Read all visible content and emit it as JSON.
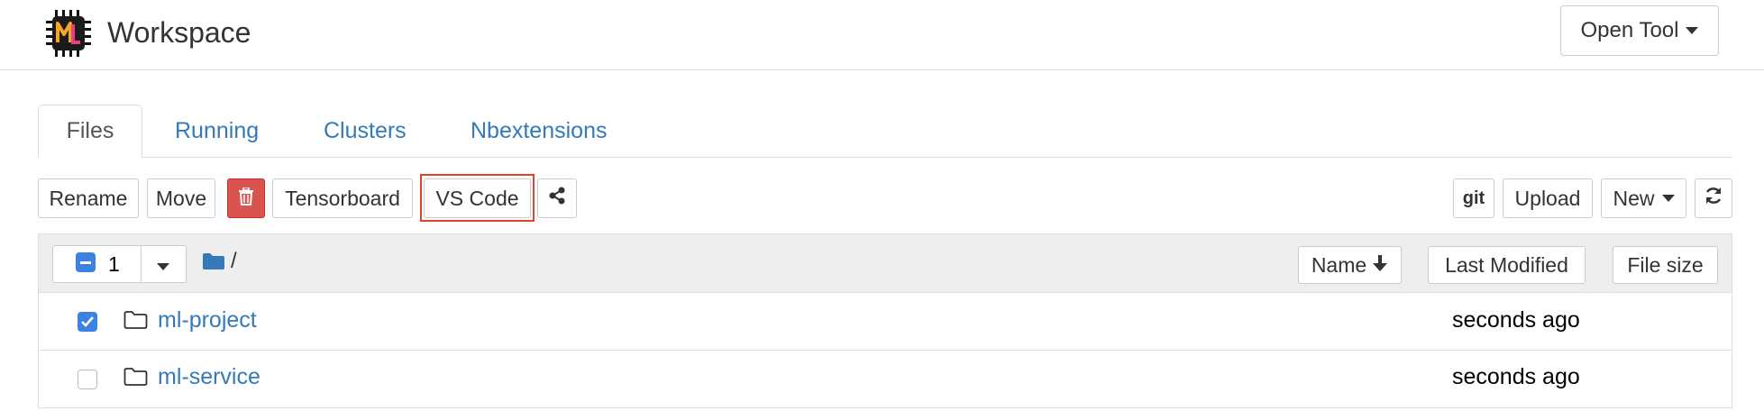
{
  "header": {
    "title": "Workspace",
    "logo_text": "ML",
    "open_tool_label": "Open Tool"
  },
  "tabs": [
    {
      "label": "Files",
      "active": true
    },
    {
      "label": "Running",
      "active": false
    },
    {
      "label": "Clusters",
      "active": false
    },
    {
      "label": "Nbextensions",
      "active": false
    }
  ],
  "toolbar": {
    "rename": "Rename",
    "move": "Move",
    "delete_icon": "trash-icon",
    "tensorboard": "Tensorboard",
    "vscode": "VS Code",
    "share_icon": "share-icon",
    "git": "git",
    "upload": "Upload",
    "new": "New",
    "refresh_icon": "refresh-icon"
  },
  "list": {
    "selected_count": "1",
    "path": "/",
    "columns": {
      "name": "Name",
      "last_modified": "Last Modified",
      "file_size": "File size"
    },
    "items": [
      {
        "name": "ml-project",
        "modified": "seconds ago",
        "checked": true
      },
      {
        "name": "ml-service",
        "modified": "seconds ago",
        "checked": false
      }
    ]
  },
  "colors": {
    "link": "#337ab7",
    "danger": "#d9534f",
    "highlight": "#e0452c",
    "checkbox": "#3c82e0"
  }
}
